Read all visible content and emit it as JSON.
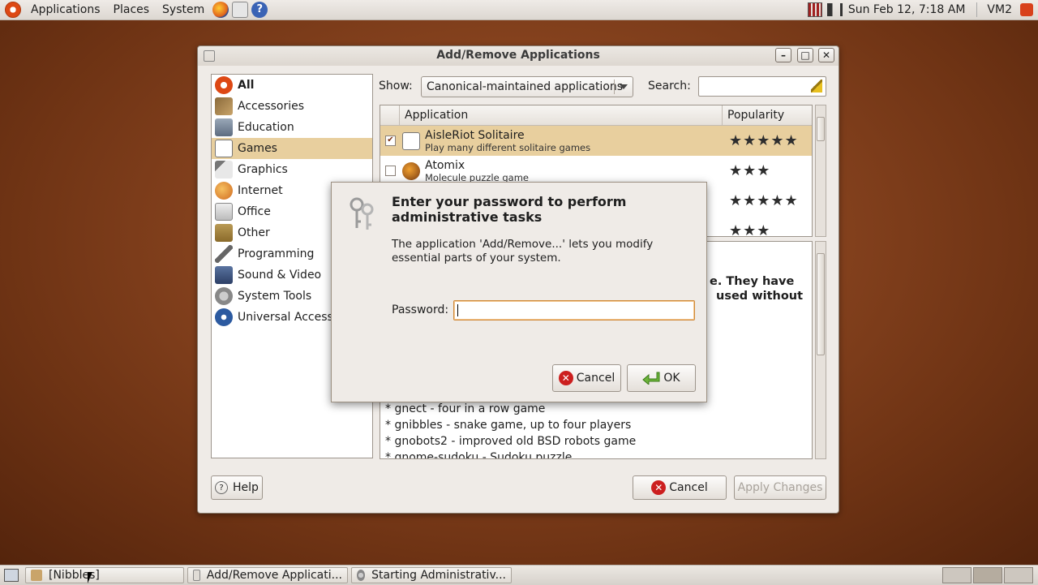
{
  "top_panel": {
    "menus": [
      "Applications",
      "Places",
      "System"
    ],
    "clock": "Sun Feb 12,  7:18 AM",
    "user": "VM2"
  },
  "window": {
    "title": "Add/Remove Applications",
    "minimize": "–",
    "maximize": "□",
    "close": "✕"
  },
  "categories": [
    {
      "label": "All",
      "icon": "ubuntu-all-icon"
    },
    {
      "label": "Accessories",
      "icon": "accessories-icon"
    },
    {
      "label": "Education",
      "icon": "education-icon"
    },
    {
      "label": "Games",
      "icon": "games-icon"
    },
    {
      "label": "Graphics",
      "icon": "graphics-icon"
    },
    {
      "label": "Internet",
      "icon": "internet-icon"
    },
    {
      "label": "Office",
      "icon": "office-icon"
    },
    {
      "label": "Other",
      "icon": "other-icon"
    },
    {
      "label": "Programming",
      "icon": "programming-icon"
    },
    {
      "label": "Sound & Video",
      "icon": "sound-video-icon"
    },
    {
      "label": "System Tools",
      "icon": "system-tools-icon"
    },
    {
      "label": "Universal Access",
      "icon": "universal-access-icon"
    }
  ],
  "filter": {
    "show_label": "Show:",
    "selected": "Canonical-maintained applications",
    "search_label": "Search:",
    "search_value": ""
  },
  "table": {
    "columns": [
      "Application",
      "Popularity"
    ],
    "rows": [
      {
        "name": "AisleRiot Solitaire",
        "desc": "Play many different solitaire games",
        "stars": "★★★★★",
        "checked": "✔"
      },
      {
        "name": "Atomix",
        "desc": "Molecule puzzle game",
        "stars": "★★★",
        "checked": ""
      },
      {
        "name": "",
        "desc": "",
        "stars": "★★★★★",
        "checked": ""
      },
      {
        "name": "",
        "desc": "",
        "stars": "★★★",
        "checked": ""
      }
    ]
  },
  "description": {
    "bold_line_1": "e. They have",
    "bold_line_2": "used without",
    "lines": [
      "* gnect - four in a row game",
      "* gnibbles - snake game, up to four players",
      "* gnobots2 - improved old BSD robots game",
      "* gnome-sudoku - Sudoku puzzle"
    ]
  },
  "buttons": {
    "help": "Help",
    "cancel": "Cancel",
    "apply": "Apply Changes"
  },
  "dialog": {
    "title": "Enter your password to perform administrative tasks",
    "message": "The application 'Add/Remove...' lets you modify essential parts of your system.",
    "password_label": "Password:",
    "password_value": "",
    "cancel": "Cancel",
    "ok": "OK"
  },
  "taskbar": [
    {
      "label": "[Nibbles]"
    },
    {
      "label": "Add/Remove Applicati..."
    },
    {
      "label": "Starting Administrativ..."
    }
  ],
  "colors": {
    "selection": "#e8cf9e",
    "accent": "#dd4814"
  }
}
